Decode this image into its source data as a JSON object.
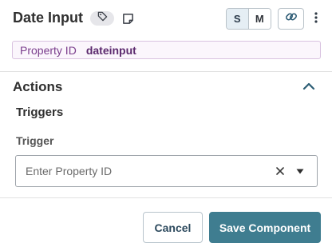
{
  "header": {
    "title": "Date Input",
    "tag_icon": "tag-icon",
    "note_icon": "note-icon",
    "size_options": [
      "S",
      "M"
    ],
    "active_size": "S",
    "link_icon": "link-icon",
    "more_icon": "more-vertical-icon"
  },
  "property": {
    "label": "Property ID",
    "value": "dateinput"
  },
  "actions": {
    "title": "Actions",
    "collapse_icon": "chevron-up-icon",
    "triggers_title": "Triggers",
    "trigger_label": "Trigger",
    "trigger_placeholder": "Enter Property ID",
    "clear_icon": "close-icon",
    "dropdown_icon": "caret-down-icon"
  },
  "footer": {
    "cancel_label": "Cancel",
    "save_label": "Save Component"
  },
  "colors": {
    "property_text": "#7a3d8c",
    "primary_button": "#3f7d90",
    "active_size_bg": "#e5eef4"
  }
}
